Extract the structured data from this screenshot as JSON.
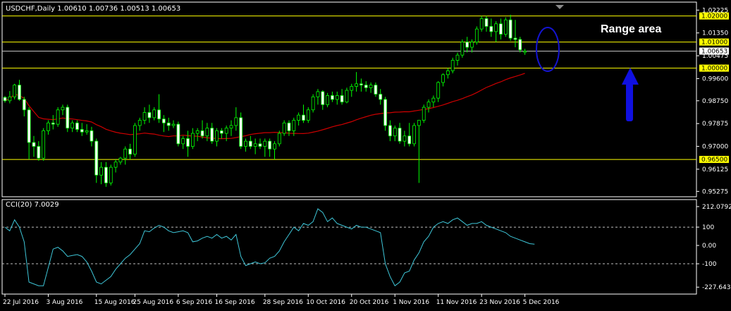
{
  "chart_data": [
    {
      "type": "candlestick",
      "title": "USDCHF,Daily  1.00610 1.00736 1.00513 1.00653",
      "colors": {
        "background": "#000000",
        "bull_fill": "#000000",
        "bear_fill": "#ffffff",
        "candle_outline": "#00ff00",
        "moving_average": "#cc0000",
        "hlines": "#ffff00",
        "price_marker": "#c0c0c0",
        "ellipse": "#1414d2",
        "arrow": "#1010e0",
        "axis": "#ffffff"
      },
      "ylim": [
        0.9515,
        1.0245
      ],
      "yticks": [
        "1.02225",
        "1.01350",
        "1.00475",
        "0.99600",
        "0.98750",
        "0.97875",
        "0.97000",
        "0.96125",
        "0.95275"
      ],
      "hlines": [
        {
          "value": 1.02,
          "label": "1.02000"
        },
        {
          "value": 1.01,
          "label": "1.01000"
        },
        {
          "value": 1.0,
          "label": "1.00000"
        },
        {
          "value": 0.965,
          "label": "0.96500"
        }
      ],
      "current_price": {
        "value": 1.00653,
        "label": "1.00653"
      },
      "xlabels": [
        {
          "index": 0,
          "label": "22 Jul 2016"
        },
        {
          "index": 9,
          "label": "3 Aug 2016"
        },
        {
          "index": 19,
          "label": "15 Aug 2016"
        },
        {
          "index": 27,
          "label": "25 Aug 2016"
        },
        {
          "index": 36,
          "label": "6 Sep 2016"
        },
        {
          "index": 44,
          "label": "16 Sep 2016"
        },
        {
          "index": 54,
          "label": "28 Sep 2016"
        },
        {
          "index": 63,
          "label": "10 Oct 2016"
        },
        {
          "index": 72,
          "label": "20 Oct 2016"
        },
        {
          "index": 81,
          "label": "1 Nov 2016"
        },
        {
          "index": 90,
          "label": "11 Nov 2016"
        },
        {
          "index": 99,
          "label": "23 Nov 2016"
        },
        {
          "index": 108,
          "label": "5 Dec 2016"
        }
      ],
      "annotation": "Range area",
      "candles": [
        [
          0.9888,
          0.9893,
          0.9868,
          0.9875
        ],
        [
          0.9875,
          0.9912,
          0.9865,
          0.989
        ],
        [
          0.989,
          0.994,
          0.988,
          0.9935
        ],
        [
          0.9935,
          0.9955,
          0.9875,
          0.988
        ],
        [
          0.988,
          0.989,
          0.9815,
          0.984
        ],
        [
          0.984,
          0.985,
          0.965,
          0.9715
        ],
        [
          0.9715,
          0.974,
          0.966,
          0.97
        ],
        [
          0.97,
          0.972,
          0.9645,
          0.9655
        ],
        [
          0.9655,
          0.977,
          0.9645,
          0.976
        ],
        [
          0.976,
          0.98,
          0.9745,
          0.979
        ],
        [
          0.979,
          0.982,
          0.9765,
          0.9785
        ],
        [
          0.9785,
          0.985,
          0.9775,
          0.984
        ],
        [
          0.984,
          0.986,
          0.982,
          0.985
        ],
        [
          0.985,
          0.986,
          0.9755,
          0.977
        ],
        [
          0.977,
          0.98,
          0.9755,
          0.979
        ],
        [
          0.979,
          0.98,
          0.9755,
          0.9765
        ],
        [
          0.9765,
          0.979,
          0.974,
          0.9755
        ],
        [
          0.9755,
          0.9785,
          0.9745,
          0.976
        ],
        [
          0.976,
          0.9775,
          0.97,
          0.972
        ],
        [
          0.972,
          0.973,
          0.956,
          0.959
        ],
        [
          0.959,
          0.964,
          0.9555,
          0.962
        ],
        [
          0.962,
          0.964,
          0.9545,
          0.956
        ],
        [
          0.956,
          0.963,
          0.955,
          0.962
        ],
        [
          0.962,
          0.965,
          0.96,
          0.964
        ],
        [
          0.964,
          0.966,
          0.963,
          0.9655
        ],
        [
          0.9655,
          0.97,
          0.963,
          0.969
        ],
        [
          0.969,
          0.971,
          0.965,
          0.967
        ],
        [
          0.967,
          0.979,
          0.966,
          0.978
        ],
        [
          0.978,
          0.981,
          0.976,
          0.98
        ],
        [
          0.98,
          0.985,
          0.9785,
          0.983
        ],
        [
          0.983,
          0.986,
          0.979,
          0.981
        ],
        [
          0.981,
          0.985,
          0.98,
          0.984
        ],
        [
          0.984,
          0.99,
          0.979,
          0.9805
        ],
        [
          0.9805,
          0.982,
          0.9755,
          0.979
        ],
        [
          0.979,
          0.981,
          0.976,
          0.978
        ],
        [
          0.978,
          0.98,
          0.977,
          0.9785
        ],
        [
          0.9785,
          0.9795,
          0.97,
          0.971
        ],
        [
          0.971,
          0.974,
          0.969,
          0.973
        ],
        [
          0.973,
          0.976,
          0.966,
          0.97
        ],
        [
          0.97,
          0.977,
          0.969,
          0.975
        ],
        [
          0.975,
          0.977,
          0.972,
          0.976
        ],
        [
          0.976,
          0.98,
          0.973,
          0.974
        ],
        [
          0.974,
          0.979,
          0.972,
          0.977
        ],
        [
          0.977,
          0.979,
          0.971,
          0.972
        ],
        [
          0.972,
          0.977,
          0.97,
          0.976
        ],
        [
          0.976,
          0.977,
          0.973,
          0.975
        ],
        [
          0.975,
          0.978,
          0.972,
          0.977
        ],
        [
          0.977,
          0.98,
          0.974,
          0.978
        ],
        [
          0.978,
          0.985,
          0.976,
          0.981
        ],
        [
          0.981,
          0.983,
          0.969,
          0.97
        ],
        [
          0.97,
          0.973,
          0.968,
          0.972
        ],
        [
          0.972,
          0.974,
          0.969,
          0.97
        ],
        [
          0.97,
          0.973,
          0.967,
          0.971
        ],
        [
          0.971,
          0.973,
          0.969,
          0.97
        ],
        [
          0.97,
          0.973,
          0.966,
          0.972
        ],
        [
          0.972,
          0.973,
          0.966,
          0.969
        ],
        [
          0.969,
          0.972,
          0.965,
          0.971
        ],
        [
          0.971,
          0.976,
          0.97,
          0.975
        ],
        [
          0.975,
          0.98,
          0.974,
          0.979
        ],
        [
          0.979,
          0.98,
          0.974,
          0.976
        ],
        [
          0.976,
          0.981,
          0.974,
          0.98
        ],
        [
          0.98,
          0.983,
          0.978,
          0.982
        ],
        [
          0.982,
          0.986,
          0.979,
          0.98
        ],
        [
          0.98,
          0.985,
          0.979,
          0.984
        ],
        [
          0.984,
          0.99,
          0.983,
          0.989
        ],
        [
          0.989,
          0.992,
          0.986,
          0.991
        ],
        [
          0.991,
          0.9915,
          0.984,
          0.986
        ],
        [
          0.986,
          0.9905,
          0.985,
          0.9895
        ],
        [
          0.9895,
          0.991,
          0.987,
          0.988
        ],
        [
          0.988,
          0.991,
          0.986,
          0.9895
        ],
        [
          0.9895,
          0.992,
          0.986,
          0.987
        ],
        [
          0.987,
          0.9925,
          0.9865,
          0.9915
        ],
        [
          0.9915,
          0.994,
          0.989,
          0.993
        ],
        [
          0.993,
          0.9985,
          0.991,
          0.994
        ],
        [
          0.994,
          0.996,
          0.991,
          0.9935
        ],
        [
          0.9935,
          0.995,
          0.991,
          0.9925
        ],
        [
          0.9925,
          0.9945,
          0.9905,
          0.9935
        ],
        [
          0.9935,
          0.9945,
          0.989,
          0.99
        ],
        [
          0.99,
          0.992,
          0.986,
          0.988
        ],
        [
          0.988,
          0.989,
          0.976,
          0.978
        ],
        [
          0.978,
          0.98,
          0.972,
          0.974
        ],
        [
          0.974,
          0.978,
          0.972,
          0.977
        ],
        [
          0.977,
          0.979,
          0.971,
          0.972
        ],
        [
          0.972,
          0.976,
          0.97,
          0.974
        ],
        [
          0.974,
          0.979,
          0.97,
          0.971
        ],
        [
          0.971,
          0.979,
          0.97,
          0.978
        ],
        [
          0.978,
          0.98,
          0.956,
          0.98
        ],
        [
          0.98,
          0.986,
          0.979,
          0.985
        ],
        [
          0.985,
          0.988,
          0.983,
          0.987
        ],
        [
          0.987,
          0.9895,
          0.985,
          0.9885
        ],
        [
          0.9885,
          0.995,
          0.987,
          0.9945
        ],
        [
          0.9945,
          0.998,
          0.993,
          0.9975
        ],
        [
          0.9975,
          1.0,
          0.996,
          0.999
        ],
        [
          0.999,
          1.004,
          0.998,
          1.003
        ],
        [
          1.003,
          1.006,
          1.001,
          1.005
        ],
        [
          1.005,
          1.011,
          1.004,
          1.01
        ],
        [
          1.01,
          1.012,
          1.006,
          1.008
        ],
        [
          1.008,
          1.011,
          1.006,
          1.01
        ],
        [
          1.01,
          1.016,
          1.009,
          1.015
        ],
        [
          1.015,
          1.02,
          1.014,
          1.019
        ],
        [
          1.019,
          1.02,
          1.014,
          1.016
        ],
        [
          1.016,
          1.019,
          1.012,
          1.014
        ],
        [
          1.014,
          1.018,
          1.01,
          1.017
        ],
        [
          1.017,
          1.019,
          1.011,
          1.013
        ],
        [
          1.013,
          1.0195,
          1.012,
          1.0185
        ],
        [
          1.0185,
          1.0205,
          1.0105,
          1.0115
        ],
        [
          1.0115,
          1.0185,
          1.008,
          1.011
        ],
        [
          1.011,
          1.012,
          1.006,
          1.007
        ],
        [
          1.0061,
          1.0074,
          1.0051,
          1.0065
        ]
      ]
    },
    {
      "type": "line",
      "title": "CCI(20) 7.0029",
      "ylim": [
        -250,
        235
      ],
      "yticks": [
        "212.0792",
        "100",
        "0.00",
        "-100",
        "-227.6436"
      ],
      "levels": [
        100,
        -100
      ],
      "colors": {
        "line": "#3ec6d8",
        "levels": "#c0c0c0"
      },
      "values": [
        100,
        80,
        140,
        100,
        20,
        -200,
        -210,
        -220,
        -220,
        -120,
        -20,
        -10,
        -30,
        -60,
        -55,
        -50,
        -60,
        -90,
        -140,
        -200,
        -210,
        -190,
        -170,
        -130,
        -100,
        -70,
        -50,
        -20,
        10,
        80,
        75,
        95,
        110,
        100,
        80,
        70,
        75,
        80,
        70,
        20,
        25,
        40,
        50,
        40,
        60,
        40,
        50,
        30,
        60,
        -60,
        -110,
        -100,
        -90,
        -100,
        -95,
        -70,
        -60,
        -30,
        20,
        60,
        100,
        80,
        120,
        110,
        130,
        200,
        180,
        130,
        150,
        120,
        110,
        100,
        90,
        110,
        100,
        100,
        90,
        80,
        70,
        -100,
        -170,
        -220,
        -200,
        -150,
        -140,
        -80,
        -40,
        20,
        50,
        100,
        120,
        130,
        120,
        140,
        150,
        130,
        110,
        120,
        120,
        130,
        110,
        100,
        90,
        80,
        70,
        50,
        40,
        30,
        20,
        10,
        7
      ]
    }
  ]
}
